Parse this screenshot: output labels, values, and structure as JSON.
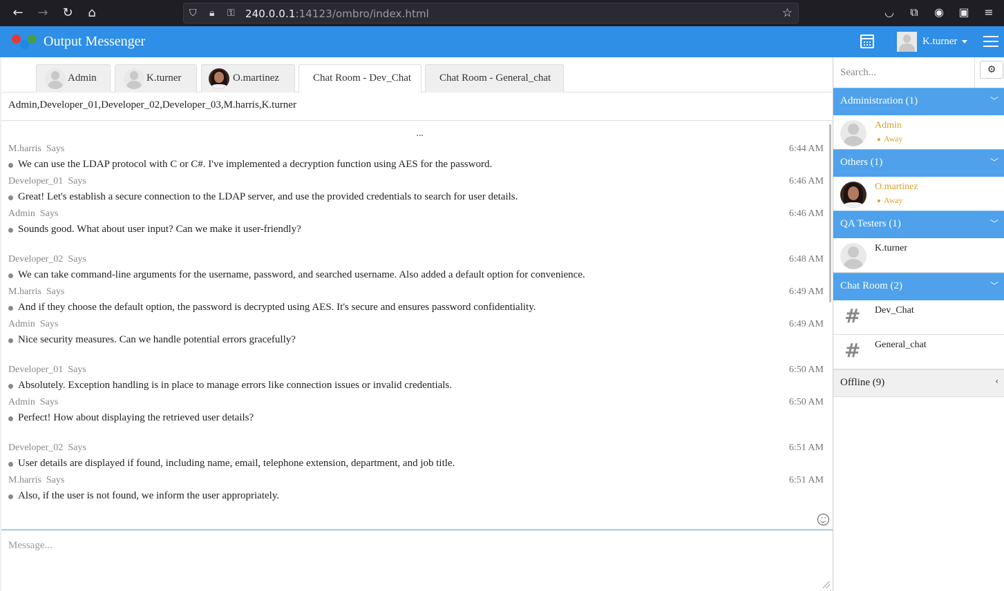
{
  "browser": {
    "url_host": "240.0.0.1",
    "url_rest": ":14123/ombro/index.html"
  },
  "app": {
    "title": "Output Messenger",
    "current_user": "K.turner",
    "colors": {
      "header": "#2f8ee5",
      "group_header": "#4ea1ea",
      "away": "#d8a22e"
    }
  },
  "tabs": [
    {
      "label": "Admin",
      "avatar": "silhouette"
    },
    {
      "label": "K.turner",
      "avatar": "silhouette"
    },
    {
      "label": "O.martinez",
      "avatar": "photo"
    },
    {
      "label": "Chat Room - Dev_Chat",
      "active": true
    },
    {
      "label": "Chat Room - General_chat"
    }
  ],
  "chat": {
    "members": "Admin,Developer_01,Developer_02,Developer_03,M.harris,K.turner",
    "more_indicator": "...",
    "messages": [
      {
        "sender": "M.harris",
        "says": "Says",
        "time": "6:44 AM",
        "text": "We can use the LDAP protocol with C or C#. I've implemented a decryption function using AES for the password."
      },
      {
        "sender": "Developer_01",
        "says": "Says",
        "time": "6:46 AM",
        "text": "Great! Let's establish a secure connection to the LDAP server, and use the provided credentials to search for user details."
      },
      {
        "sender": "Admin",
        "says": "Says",
        "time": "6:46 AM",
        "text": "Sounds good. What about user input? Can we make it user-friendly?"
      },
      {
        "sender": "Developer_02",
        "says": "Says",
        "time": "6:48 AM",
        "text": "We can take command-line arguments for the username, password, and searched username. Also added a default option for convenience."
      },
      {
        "sender": "M.harris",
        "says": "Says",
        "time": "6:49 AM",
        "text": "And if they choose the default option, the password is decrypted using AES. It's secure and ensures password confidentiality."
      },
      {
        "sender": "Admin",
        "says": "Says",
        "time": "6:49 AM",
        "text": "Nice security measures. Can we handle potential errors gracefully?"
      },
      {
        "sender": "Developer_01",
        "says": "Says",
        "time": "6:50 AM",
        "text": "Absolutely. Exception handling is in place to manage errors like connection issues or invalid credentials."
      },
      {
        "sender": "Admin",
        "says": "Says",
        "time": "6:50 AM",
        "text": "Perfect! How about displaying the retrieved user details?"
      },
      {
        "sender": "Developer_02",
        "says": "Says",
        "time": "6:51 AM",
        "text": "User details are displayed if found, including name, email, telephone extension, department, and job title."
      },
      {
        "sender": "M.harris",
        "says": "Says",
        "time": "6:51 AM",
        "text": "Also, if the user is not found, we inform the user appropriately."
      }
    ],
    "composer_placeholder": "Message..."
  },
  "sidebar": {
    "search_placeholder": "Search...",
    "settings_icon": "gear-icon",
    "groups": [
      {
        "label": "Administration (1)",
        "contacts": [
          {
            "name": "Admin",
            "status": "Away",
            "avatar": "silhouette"
          }
        ]
      },
      {
        "label": "Others (1)",
        "contacts": [
          {
            "name": "O.martinez",
            "status": "Away",
            "avatar": "photo"
          }
        ]
      },
      {
        "label": "QA Testers (1)",
        "contacts": [
          {
            "name": "K.turner",
            "avatar": "silhouette"
          }
        ]
      },
      {
        "label": "Chat Room (2)",
        "rooms": [
          {
            "name": "Dev_Chat"
          },
          {
            "name": "General_chat"
          }
        ]
      },
      {
        "label": "Offline (9)"
      }
    ]
  }
}
